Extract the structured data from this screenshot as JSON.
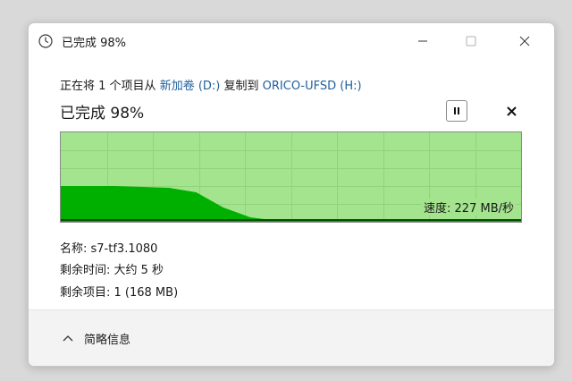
{
  "title_bar": {
    "title": "已完成 98%",
    "icon": "clock-icon",
    "buttons": [
      "minimize-icon",
      "maximize-icon",
      "close-icon"
    ]
  },
  "copy_line": {
    "prefix": "正在将 1 个项目从",
    "source": "新加卷 (D:)",
    "middle": "复制到",
    "destination": "ORICO-UFSD (H:)"
  },
  "progress": {
    "label": "已完成 98%",
    "percent": 98
  },
  "controls": {
    "pause_icon": "pause-icon",
    "close_icon": "close-icon"
  },
  "graph": {
    "speed_text": "速度: 227 MB/秒",
    "fill_color": "#a4e48e",
    "speed_color": "#00b000",
    "line_color": "#005000",
    "speed_history": [
      0.4,
      0.4,
      0.4,
      0.39,
      0.38,
      0.33,
      0.16,
      0.05,
      0.01,
      0.01,
      0.01,
      0.02,
      0.02,
      0.01,
      0.01,
      0.01,
      0.01,
      0.01
    ],
    "current_speed_level": 0.02
  },
  "info": {
    "name": "名称: s7-tf3.1080",
    "time_remaining": "剩余时间: 大约 5 秒",
    "items_remaining": "剩余项目: 1 (168 MB)"
  },
  "footer": {
    "details_label": "简略信息",
    "details_icon": "chevron-up-icon"
  }
}
